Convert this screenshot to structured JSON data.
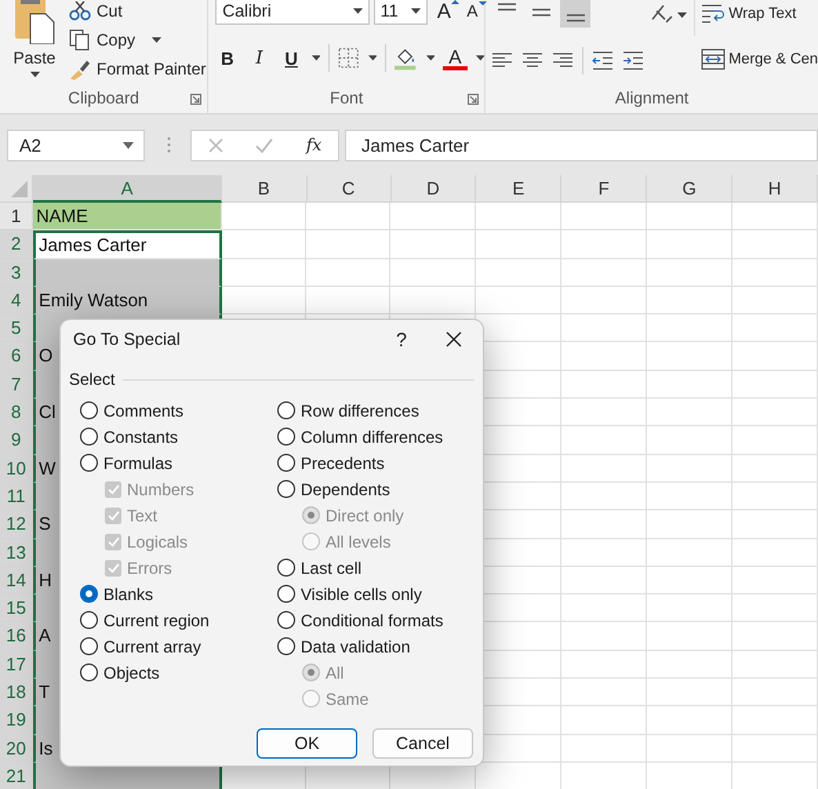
{
  "ribbon": {
    "clipboard": {
      "paste": "Paste",
      "cut": "Cut",
      "copy": "Copy",
      "format_painter": "Format Painter",
      "label": "Clipboard"
    },
    "font": {
      "font_name": "Calibri",
      "font_size": "11",
      "grow_font": "A",
      "shrink_font": "A",
      "bold": "B",
      "italic": "I",
      "underline": "U",
      "font_color": "A",
      "label": "Font"
    },
    "alignment": {
      "vertical_align": [
        {
          "selected": false
        },
        {
          "selected": false
        },
        {
          "selected": true
        }
      ],
      "wrap_text": "Wrap Text",
      "merge": "Merge & Cen",
      "label": "Alignment"
    }
  },
  "formula_bar": {
    "name_box": "A2",
    "function_label": "fx",
    "content": "James Carter"
  },
  "columns": [
    {
      "label": "A",
      "selected": true
    },
    {
      "label": "B",
      "selected": false
    },
    {
      "label": "C",
      "selected": false
    },
    {
      "label": "D",
      "selected": false
    },
    {
      "label": "E",
      "selected": false
    },
    {
      "label": "F",
      "selected": false
    },
    {
      "label": "G",
      "selected": false
    },
    {
      "label": "H",
      "selected": false
    }
  ],
  "rows": [
    {
      "label": "1",
      "kind": "header",
      "selected": false,
      "active": false,
      "cell_a": "NAME"
    },
    {
      "label": "2",
      "kind": "data",
      "selected": true,
      "active": true,
      "cell_a": "James Carter"
    },
    {
      "label": "3",
      "kind": "data",
      "selected": true,
      "active": false
    },
    {
      "label": "4",
      "kind": "data",
      "selected": true,
      "active": false,
      "cell_a": "Emily Watson"
    },
    {
      "label": "5",
      "kind": "data",
      "selected": true,
      "active": false
    },
    {
      "label": "6",
      "kind": "data",
      "selected": true,
      "active": false,
      "cell_a": "O"
    },
    {
      "label": "7",
      "kind": "data",
      "selected": true,
      "active": false
    },
    {
      "label": "8",
      "kind": "data",
      "selected": true,
      "active": false,
      "cell_a": "Cl"
    },
    {
      "label": "9",
      "kind": "data",
      "selected": true,
      "active": false
    },
    {
      "label": "10",
      "kind": "data",
      "selected": true,
      "active": false,
      "cell_a": "W"
    },
    {
      "label": "11",
      "kind": "data",
      "selected": true,
      "active": false
    },
    {
      "label": "12",
      "kind": "data",
      "selected": true,
      "active": false,
      "cell_a": "S"
    },
    {
      "label": "13",
      "kind": "data",
      "selected": true,
      "active": false
    },
    {
      "label": "14",
      "kind": "data",
      "selected": true,
      "active": false,
      "cell_a": "H"
    },
    {
      "label": "15",
      "kind": "data",
      "selected": true,
      "active": false
    },
    {
      "label": "16",
      "kind": "data",
      "selected": true,
      "active": false,
      "cell_a": "A"
    },
    {
      "label": "17",
      "kind": "data",
      "selected": true,
      "active": false
    },
    {
      "label": "18",
      "kind": "data",
      "selected": true,
      "active": false,
      "cell_a": "T"
    },
    {
      "label": "19",
      "kind": "data",
      "selected": true,
      "active": false
    },
    {
      "label": "20",
      "kind": "data",
      "selected": true,
      "active": false,
      "cell_a": "Is"
    },
    {
      "label": "21",
      "kind": "data",
      "selected": true,
      "active": false
    }
  ],
  "dialog": {
    "title": "Go To Special",
    "help": "?",
    "group_label": "Select",
    "left_options": [
      {
        "label": "Comments",
        "selected": false,
        "disabled": false
      },
      {
        "label": "Constants",
        "selected": false,
        "disabled": false
      },
      {
        "label": "Formulas",
        "selected": false,
        "disabled": false,
        "children": [
          {
            "label": "Numbers",
            "checked": true,
            "disabled": true
          },
          {
            "label": "Text",
            "checked": true,
            "disabled": true
          },
          {
            "label": "Logicals",
            "checked": true,
            "disabled": true
          },
          {
            "label": "Errors",
            "checked": true,
            "disabled": true
          }
        ]
      },
      {
        "label": "Blanks",
        "selected": true,
        "disabled": false
      },
      {
        "label": "Current region",
        "selected": false,
        "disabled": false
      },
      {
        "label": "Current array",
        "selected": false,
        "disabled": false
      },
      {
        "label": "Objects",
        "selected": false,
        "disabled": false
      }
    ],
    "right_options": [
      {
        "label": "Row differences",
        "selected": false,
        "disabled": false
      },
      {
        "label": "Column differences",
        "selected": false,
        "disabled": false
      },
      {
        "label": "Precedents",
        "selected": false,
        "disabled": false
      },
      {
        "label": "Dependents",
        "selected": false,
        "disabled": false,
        "children": [
          {
            "label": "Direct only",
            "selected": true,
            "disabled": true
          },
          {
            "label": "All levels",
            "selected": false,
            "disabled": true
          }
        ]
      },
      {
        "label": "Last cell",
        "selected": false,
        "disabled": false
      },
      {
        "label": "Visible cells only",
        "selected": false,
        "disabled": false
      },
      {
        "label": "Conditional formats",
        "selected": false,
        "disabled": false
      },
      {
        "label": "Data validation",
        "selected": false,
        "disabled": false,
        "children": [
          {
            "label": "All",
            "selected": true,
            "disabled": true
          },
          {
            "label": "Same",
            "selected": false,
            "disabled": true
          }
        ]
      }
    ],
    "buttons": [
      {
        "label": "OK",
        "default": true
      },
      {
        "label": "Cancel",
        "default": false
      }
    ]
  }
}
